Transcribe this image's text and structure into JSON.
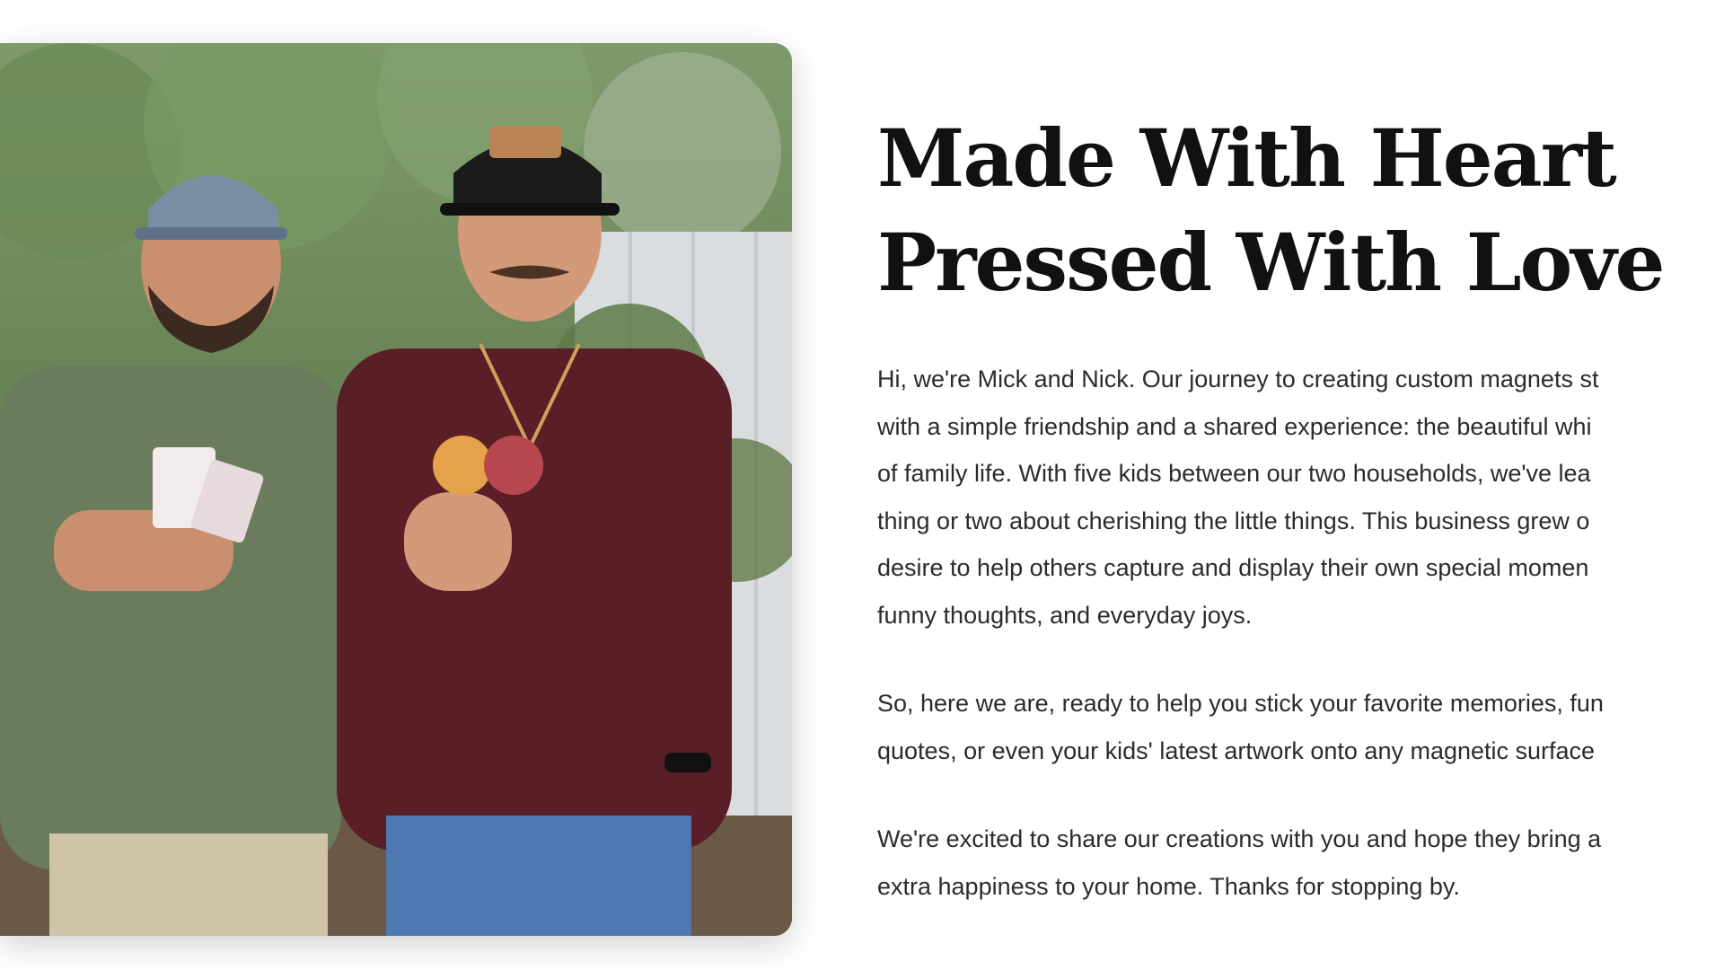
{
  "photo": {
    "alt_icon": "photo-icon"
  },
  "headline": {
    "line1": "Made With Heart",
    "line2": "Pressed With Love"
  },
  "paragraphs": [
    {
      "lines": [
        "Hi, we're Mick and Nick. Our journey to creating custom magnets st",
        "with a simple friendship and a shared experience: the beautiful whi",
        "of family life. With five kids between our two households, we've lea",
        "thing or two about cherishing the little things. This business grew o",
        "desire to help others capture and display their own special momen",
        "funny thoughts, and everyday joys."
      ]
    },
    {
      "lines": [
        "So, here we are, ready to help you stick your favorite memories, fun",
        "quotes, or even your kids' latest artwork onto any magnetic surface"
      ]
    },
    {
      "lines": [
        "We're excited to share our creations with you and hope they bring a",
        "extra happiness to your home. Thanks for stopping by."
      ]
    }
  ],
  "colors": {
    "heading": "#111111",
    "body": "#2b2b2b",
    "background": "#ffffff"
  }
}
